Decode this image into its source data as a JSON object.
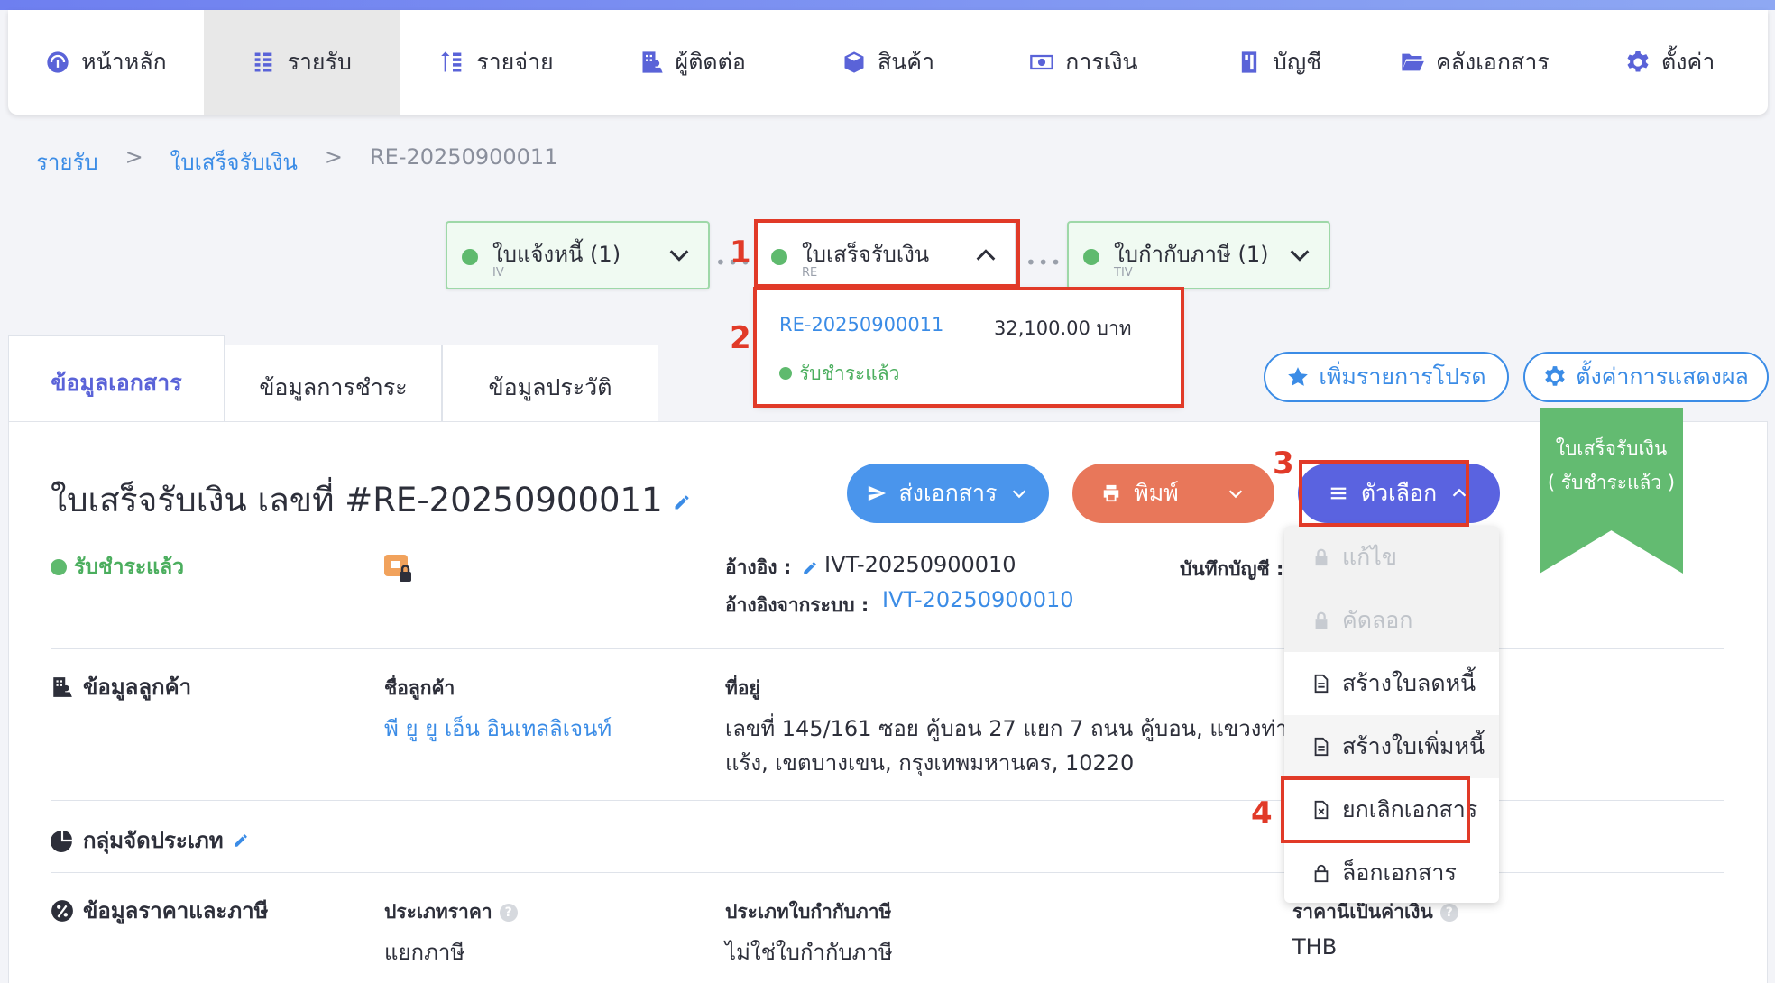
{
  "nav": {
    "items": [
      {
        "label": "หน้าหลัก",
        "icon": "dashboard-icon"
      },
      {
        "label": "รายรับ",
        "icon": "income-icon"
      },
      {
        "label": "รายจ่าย",
        "icon": "expense-icon"
      },
      {
        "label": "ผู้ติดต่อ",
        "icon": "contacts-icon"
      },
      {
        "label": "สินค้า",
        "icon": "product-box-icon"
      },
      {
        "label": "การเงิน",
        "icon": "money-icon"
      },
      {
        "label": "บัญชี",
        "icon": "accounting-book-icon"
      },
      {
        "label": "คลังเอกสาร",
        "icon": "folder-icon"
      },
      {
        "label": "ตั้งค่า",
        "icon": "gear-icon"
      }
    ],
    "active_index": 1
  },
  "breadcrumb": {
    "level1": "รายรับ",
    "sep1": ">",
    "level2": "ใบเสร็จรับเงิน",
    "sep2": ">",
    "current": "RE-20250900011"
  },
  "flow": {
    "step1": {
      "label": "ใบแจ้งหนี้ (1)",
      "sub": "IV"
    },
    "step2": {
      "label": "ใบเสร็จรับเงิน",
      "sub": "RE"
    },
    "step3": {
      "label": "ใบกำกับภาษี (1)",
      "sub": "TIV"
    },
    "popup": {
      "doc_no": "RE-20250900011",
      "amount": "32,100.00 บาท",
      "status": "รับชำระแล้ว"
    }
  },
  "annotations": {
    "n1": "1",
    "n2": "2",
    "n3": "3",
    "n4": "4"
  },
  "tabs": [
    {
      "label": "ข้อมูลเอกสาร"
    },
    {
      "label": "ข้อมูลการชำระ"
    },
    {
      "label": "ข้อมูลประวัติ"
    }
  ],
  "actions": {
    "favorite": "เพิ่มรายการโปรด",
    "display_settings": "ตั้งค่าการแสดงผล"
  },
  "doc": {
    "title": "ใบเสร็จรับเงิน เลขที่ #RE-20250900011",
    "status": "รับชำระแล้ว",
    "ref_label": "อ้างอิง :",
    "ref_value": "IVT-20250900010",
    "sysref_label": "อ้างอิงจากระบบ :",
    "sysref_value": "IVT-20250900010",
    "journal_label": "บันทึกบัญชี :"
  },
  "buttons": {
    "send": "ส่งเอกสาร",
    "print": "พิมพ์",
    "options": "ตัวเลือก"
  },
  "ribbon": {
    "line1": "ใบเสร็จรับเงิน",
    "line2": "( รับชำระแล้ว )"
  },
  "menu": {
    "items": [
      {
        "label": "แก้ไข",
        "icon": "lock-icon",
        "disabled": true
      },
      {
        "label": "คัดลอก",
        "icon": "lock-icon",
        "disabled": true
      },
      {
        "label": "สร้างใบลดหนี้",
        "icon": "document-icon"
      },
      {
        "label": "สร้างใบเพิ่มหนี้",
        "icon": "document-icon"
      },
      {
        "label": "ยกเลิกเอกสาร",
        "icon": "document-cancel-icon"
      },
      {
        "label": "ล็อกเอกสาร",
        "icon": "lock-open-icon"
      }
    ]
  },
  "customer": {
    "section": "ข้อมูลลูกค้า",
    "name_label": "ชื่อลูกค้า",
    "name": "พี ยู ยู เอ็น อินเทลลิเจนท์",
    "address_label": "ที่อยู่",
    "address_line1": "เลขที่ 145/161 ซอย คู้บอน 27 แยก 7 ถนน คู้บอน, แขวงท่า",
    "address_line2": "แร้ง, เขตบางเขน, กรุงเทพมหานคร, 10220"
  },
  "group": {
    "section": "กลุ่มจัดประเภท"
  },
  "price": {
    "section": "ข้อมูลราคาและภาษี",
    "type_label": "ประเภทราคา",
    "type_value": "แยกภาษี",
    "tax_label": "ประเภทใบกำกับภาษี",
    "tax_value": "ไม่ใช่ใบกำกับภาษี",
    "currency_label": "ราคานี้เป็นค่าเงิน",
    "currency_value": "THB"
  },
  "colors": {
    "accent": "#5a63d8",
    "link": "#3b8ce6",
    "success": "#5fba6e",
    "print": "#e8775a",
    "annotation": "#e13a28"
  }
}
